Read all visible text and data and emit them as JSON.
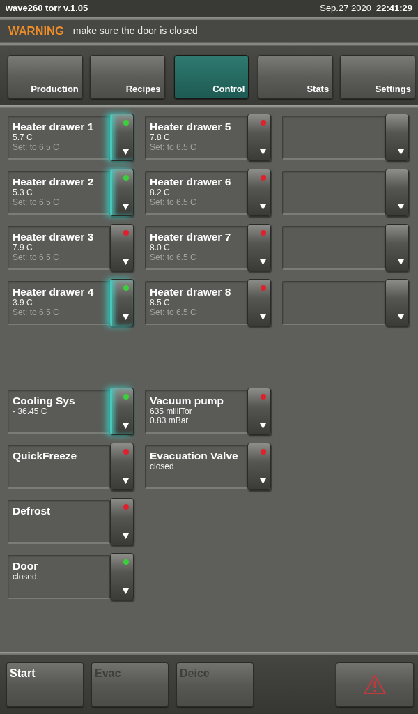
{
  "header": {
    "title": "wave260 torr v.1.05",
    "date": "Sep.27 2020",
    "time": "22:41:29"
  },
  "warning": {
    "label": "WARNING",
    "message": "make sure the door is closed"
  },
  "tabs": [
    {
      "label": "Production",
      "selected": false
    },
    {
      "label": "Recipes",
      "selected": false
    },
    {
      "label": "Control",
      "selected": true
    },
    {
      "label": "Stats",
      "selected": false
    },
    {
      "label": "Settings",
      "selected": false
    }
  ],
  "heater_panel": {
    "columns": [
      {
        "tiles": [
          {
            "kind": "sensor",
            "name": "Heater drawer 1",
            "readings": [
              "5.7 C"
            ],
            "setpoint": "Set: to 6.5 C",
            "color": "#3ccf3c",
            "highlighted": true
          },
          {
            "kind": "sensor",
            "name": "Heater drawer 2",
            "readings": [
              "5.3 C"
            ],
            "setpoint": "Set: to 6.5 C",
            "color": "#3ccf3c",
            "highlighted": true
          },
          {
            "kind": "sensor",
            "name": "Heater drawer 3",
            "readings": [
              "7.9 C"
            ],
            "setpoint": "Set: to 6.5 C",
            "color": "#e0202c",
            "highlighted": false
          },
          {
            "kind": "sensor",
            "name": "Heater drawer 4",
            "readings": [
              "3.9 C"
            ],
            "setpoint": "Set: to 6.5 C",
            "color": "#3ccf3c",
            "highlighted": true
          }
        ]
      },
      {
        "tiles": [
          {
            "kind": "sensor",
            "name": "Heater drawer 5",
            "readings": [
              "7.8 C"
            ],
            "setpoint": "Set: to 6.5 C",
            "color": "#e0202c",
            "highlighted": false
          },
          {
            "kind": "sensor",
            "name": "Heater drawer 6",
            "readings": [
              "8.2 C"
            ],
            "setpoint": "Set: to 6.5 C",
            "color": "#e0202c",
            "highlighted": false
          },
          {
            "kind": "sensor",
            "name": "Heater drawer 7",
            "readings": [
              "8.0 C"
            ],
            "setpoint": "Set: to 6.5 C",
            "color": "#e0202c",
            "highlighted": false
          },
          {
            "kind": "sensor",
            "name": "Heater drawer 8",
            "readings": [
              "8.5 C"
            ],
            "setpoint": "Set: to 6.5 C",
            "color": "#e0202c",
            "highlighted": false
          }
        ]
      },
      {
        "tiles": [
          {
            "kind": "empty"
          },
          {
            "kind": "empty"
          },
          {
            "kind": "empty"
          },
          {
            "kind": "empty"
          }
        ]
      }
    ]
  },
  "system_panel": {
    "columns": [
      {
        "tiles": [
          {
            "kind": "sensor",
            "name": "Cooling Sys",
            "readings": [
              "- 36.45 C"
            ],
            "color": "#3ccf3c",
            "highlighted": true
          },
          {
            "kind": "sensor",
            "name": "QuickFreeze",
            "color": "#e0202c",
            "highlighted": false
          },
          {
            "kind": "sensor",
            "name": "Defrost",
            "color": "#e0202c",
            "highlighted": false
          },
          {
            "kind": "sensor",
            "name": "Door",
            "readings": [
              "closed"
            ],
            "color": "#3ccf3c",
            "highlighted": false
          }
        ]
      },
      {
        "tiles": [
          {
            "kind": "sensor",
            "name": "Vacuum pump",
            "readings": [
              "635 milliTor",
              "0.83 mBar"
            ],
            "color": "#e0202c",
            "highlighted": false
          },
          {
            "kind": "sensor",
            "name": "Evacuation Valve",
            "readings": [
              "closed"
            ],
            "color": "#e0202c",
            "highlighted": false
          }
        ]
      }
    ]
  },
  "actions": [
    {
      "label": "Start",
      "disabled": false
    },
    {
      "label": "Evac",
      "disabled": true
    },
    {
      "label": "Deice",
      "disabled": true
    }
  ]
}
